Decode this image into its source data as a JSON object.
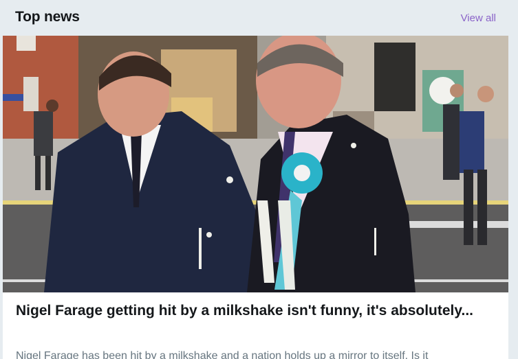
{
  "header": {
    "title": "Top news",
    "view_all_label": "View all"
  },
  "article": {
    "headline": "Nigel Farage getting hit by a milkshake isn't funny, it's absolutely...",
    "summary": "Nigel Farage has been hit by a milkshake and a nation holds up a mirror to itself. Is it"
  },
  "colors": {
    "link": "#8a63c8",
    "background": "#e6ecf0",
    "rosette": "#2ab3c9"
  }
}
